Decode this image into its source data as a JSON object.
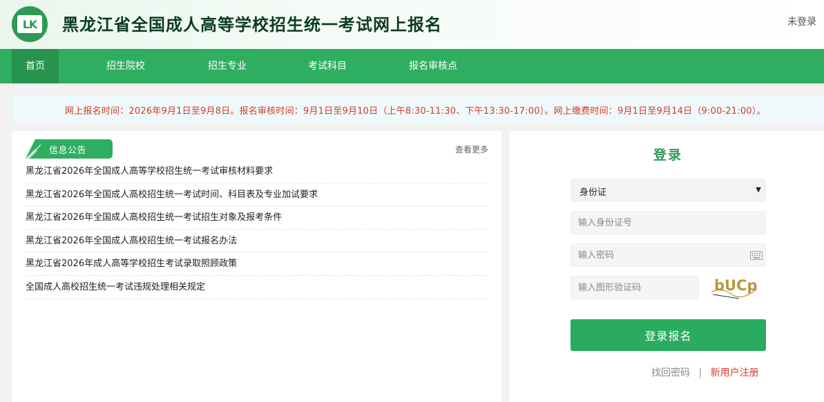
{
  "header": {
    "title": "黑龙江省全国成人高等学校招生统一考试网上报名",
    "login_status": "未登录",
    "logo_text": "LK"
  },
  "nav": {
    "items": [
      {
        "label": "首页",
        "active": true
      },
      {
        "label": "招生院校"
      },
      {
        "label": "招生专业"
      },
      {
        "label": "考试科目"
      },
      {
        "label": "报名审核点"
      }
    ]
  },
  "notice": {
    "text": "网上报名时间：2026年9月1日至9月8日。报名审核时间：9月1日至9月10日（上午8:30-11:30、下午13:30-17:00）。网上缴费时间：9月1日至9月14日（9:00-21:00）。"
  },
  "announcements": {
    "heading": "信息公告",
    "more_label": "查看更多",
    "items": [
      "黑龙江省2026年全国成人高等学校招生统一考试审核材料要求",
      "黑龙江省2026年全国成人高校招生统一考试时间、科目表及专业加试要求",
      "黑龙江省2026年全国成人高校招生统一考试招生对象及报考条件",
      "黑龙江省2026年全国成人高校招生统一考试报名办法",
      "黑龙江省2026年成人高等学校招生考试录取照顾政策",
      "全国成人高校招生统一考试违规处理相关规定"
    ]
  },
  "login": {
    "title": "登录",
    "id_type_selected": "身份证",
    "id_placeholder": "输入身份证号",
    "password_placeholder": "输入密码",
    "captcha_placeholder": "输入图形验证码",
    "captcha_text": "bUCp",
    "submit_label": "登录报名",
    "forgot_label": "找回密码",
    "separator": "|",
    "register_label": "新用户注册"
  },
  "colors": {
    "brand_green": "#2fae61",
    "nav_active": "#27934f",
    "notice_red": "#d43a2a",
    "title_dark": "#0d3b22"
  }
}
